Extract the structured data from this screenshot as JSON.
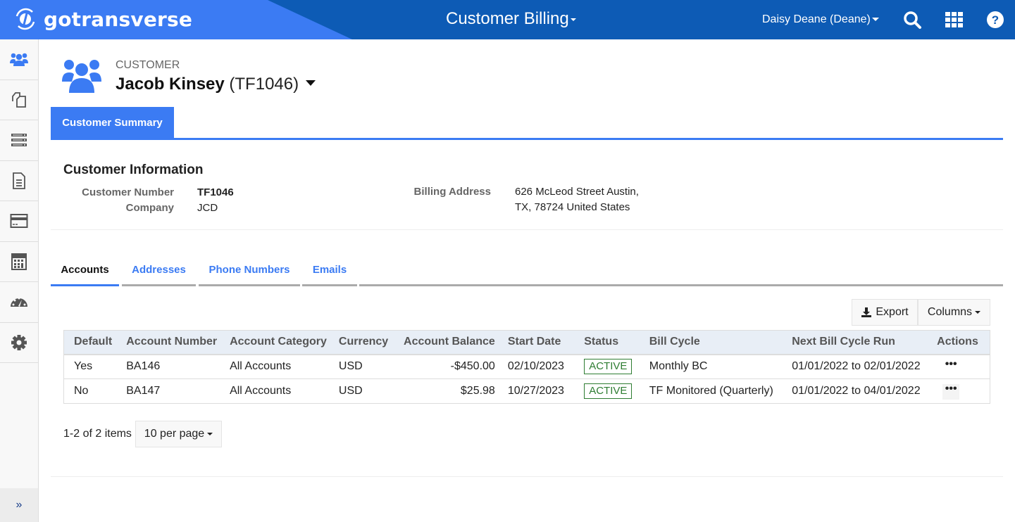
{
  "topbar": {
    "brand": "gotransverse",
    "app_title": "Customer Billing",
    "user": "Daisy Deane (Deane)",
    "icons": [
      "search-icon",
      "apps-grid-icon",
      "help-icon"
    ]
  },
  "sidebar": {
    "items": [
      {
        "name": "customers",
        "icon": "users-icon",
        "active": true
      },
      {
        "name": "documents",
        "icon": "copy-icon"
      },
      {
        "name": "servers",
        "icon": "server-list-icon"
      },
      {
        "name": "invoices",
        "icon": "document-icon"
      },
      {
        "name": "payments",
        "icon": "credit-card-icon"
      },
      {
        "name": "calculator",
        "icon": "calculator-icon"
      },
      {
        "name": "dashboard",
        "icon": "gauge-icon"
      },
      {
        "name": "settings",
        "icon": "gear-icon"
      }
    ],
    "expand_label": "»"
  },
  "customer": {
    "label": "CUSTOMER",
    "name": "Jacob Kinsey",
    "code": "(TF1046)"
  },
  "main_tabs": [
    {
      "label": "Customer Summary",
      "active": true
    }
  ],
  "info": {
    "title": "Customer Information",
    "customer_number_label": "Customer Number",
    "customer_number": "TF1046",
    "company_label": "Company",
    "company": "JCD",
    "billing_address_label": "Billing Address",
    "billing_address_line1": "626 McLeod Street Austin,",
    "billing_address_line2": "TX, 78724 United States"
  },
  "sub_tabs": [
    {
      "label": "Accounts",
      "active": true
    },
    {
      "label": "Addresses"
    },
    {
      "label": "Phone Numbers"
    },
    {
      "label": "Emails"
    }
  ],
  "toolbar": {
    "export_label": "Export",
    "columns_label": "Columns"
  },
  "table": {
    "headers": [
      "Default",
      "Account Number",
      "Account Category",
      "Currency",
      "Account Balance",
      "Start Date",
      "Status",
      "Bill Cycle",
      "Next Bill Cycle Run",
      "Actions"
    ],
    "rows": [
      {
        "default": "Yes",
        "account_number": "BA146",
        "category": "All Accounts",
        "currency": "USD",
        "balance": "-$450.00",
        "start_date": "02/10/2023",
        "status": "ACTIVE",
        "bill_cycle": "Monthly BC",
        "next_run": "01/01/2022 to 02/01/2022",
        "actions": "•••"
      },
      {
        "default": "No",
        "account_number": "BA147",
        "category": "All Accounts",
        "currency": "USD",
        "balance": "$25.98",
        "start_date": "10/27/2023",
        "status": "ACTIVE",
        "bill_cycle": "TF Monitored (Quarterly)",
        "next_run": "01/01/2022 to 04/01/2022",
        "actions": "•••"
      }
    ]
  },
  "pager": {
    "summary": "1-2 of 2 items",
    "per_page": "10 per page"
  },
  "colors": {
    "brand_blue": "#3b7bf3",
    "topbar_dark": "#0d5bb5",
    "status_green": "#2e7d32"
  }
}
